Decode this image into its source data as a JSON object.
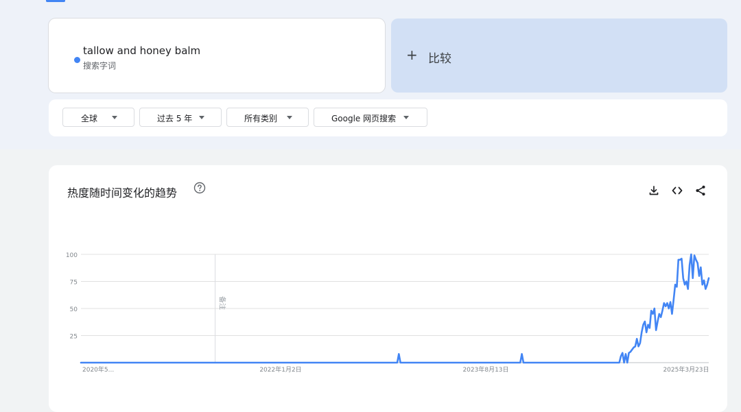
{
  "search_term": {
    "name": "tallow and honey balm",
    "type": "搜索字词",
    "color": "#4285f4"
  },
  "compare": {
    "icon": "plus-icon",
    "label": "比较"
  },
  "filters": [
    {
      "label": "全球",
      "icon": "caret-down-icon"
    },
    {
      "label": "过去 5 年",
      "icon": "caret-down-icon"
    },
    {
      "label": "所有类别",
      "icon": "caret-down-icon"
    },
    {
      "label": "Google 网页搜索",
      "icon": "caret-down-icon"
    }
  ],
  "chart_card": {
    "title": "热度随时间变化的趋势",
    "help_icon": "help-circle-icon",
    "tools": [
      "download-icon",
      "embed-code-icon",
      "share-icon"
    ]
  },
  "chart_data": {
    "type": "line",
    "series": [
      {
        "name": "tallow and honey balm",
        "color": "#4285f4",
        "values": [
          0,
          0,
          0,
          0,
          0,
          0,
          0,
          0,
          0,
          0,
          0,
          0,
          0,
          0,
          0,
          0,
          0,
          0,
          0,
          0,
          0,
          0,
          0,
          0,
          0,
          0,
          0,
          0,
          0,
          0,
          0,
          0,
          0,
          0,
          0,
          0,
          0,
          0,
          0,
          0,
          0,
          0,
          0,
          0,
          0,
          0,
          0,
          0,
          0,
          0,
          0,
          0,
          0,
          0,
          0,
          0,
          0,
          0,
          0,
          0,
          0,
          0,
          0,
          0,
          0,
          0,
          0,
          0,
          0,
          0,
          0,
          0,
          0,
          0,
          0,
          0,
          0,
          0,
          0,
          0,
          0,
          0,
          0,
          0,
          0,
          0,
          0,
          0,
          0,
          0,
          0,
          0,
          0,
          0,
          0,
          0,
          0,
          0,
          0,
          0,
          0,
          0,
          0,
          0,
          0,
          0,
          0,
          0,
          0,
          0,
          0,
          0,
          0,
          0,
          0,
          0,
          0,
          0,
          0,
          0,
          0,
          0,
          0,
          0,
          0,
          0,
          0,
          0,
          0,
          0,
          0,
          0,
          0,
          0,
          0,
          0,
          0,
          0,
          0,
          0,
          0,
          0,
          0,
          0,
          0,
          0,
          0,
          0,
          0,
          0,
          0,
          0,
          0,
          0,
          0,
          0,
          0,
          0,
          0,
          0,
          0,
          0,
          0,
          0,
          0,
          0,
          0,
          0,
          0,
          0,
          0,
          0,
          0,
          0,
          0,
          0,
          0,
          0,
          0,
          0,
          0,
          0,
          0,
          0,
          0,
          0,
          0,
          0,
          0,
          0,
          0,
          0,
          0,
          0,
          0,
          0,
          0,
          0,
          0,
          8,
          0,
          0,
          0,
          0,
          0,
          0,
          0,
          0,
          0,
          0,
          0,
          0,
          0,
          0,
          0,
          0,
          0,
          0,
          0,
          0,
          0,
          0,
          0,
          0,
          0,
          0,
          0,
          0,
          0,
          0,
          0,
          0,
          0,
          0,
          0,
          0,
          0,
          0,
          0,
          0,
          0,
          0,
          0,
          0,
          0,
          0,
          0,
          0,
          0,
          0,
          0,
          0,
          0,
          0,
          0,
          0,
          0,
          0,
          0,
          0,
          0,
          0,
          0,
          0,
          0,
          0,
          0,
          0,
          0,
          0,
          0,
          0,
          0,
          0,
          0,
          0,
          8,
          0,
          0,
          0,
          0,
          0,
          0,
          0,
          0,
          0,
          0,
          0,
          0,
          0,
          0,
          0,
          0,
          0,
          0,
          0,
          0,
          0,
          0,
          0,
          0,
          0,
          0,
          0,
          0,
          0,
          0,
          0,
          0,
          0,
          0,
          0,
          0,
          0,
          0,
          0,
          0,
          0,
          0,
          0,
          0,
          0,
          0,
          0,
          0,
          0,
          0,
          0,
          0,
          0,
          0,
          0,
          0,
          0,
          0,
          0,
          0,
          0,
          6,
          9,
          0,
          8,
          0,
          9,
          10,
          12,
          14,
          15,
          22,
          15,
          18,
          28,
          35,
          38,
          28,
          35,
          32,
          48,
          45,
          50,
          30,
          38,
          45,
          42,
          48,
          55,
          52,
          55,
          50,
          56,
          45,
          58,
          72,
          70,
          95,
          95,
          96,
          78,
          72,
          75,
          68,
          90,
          100,
          78,
          99,
          95,
          92,
          80,
          88,
          72,
          76,
          68,
          72,
          78
        ]
      }
    ],
    "x_tick_labels": [
      "2020年5...",
      "2022年1月2日",
      "2023年8月13日",
      "2025年3月23日"
    ],
    "y_ticks": [
      100,
      75,
      50,
      25
    ],
    "ylim": [
      0,
      100
    ],
    "annotations": [
      {
        "text": "备注",
        "at_index": 84
      }
    ],
    "grid": true,
    "legend": "none"
  }
}
